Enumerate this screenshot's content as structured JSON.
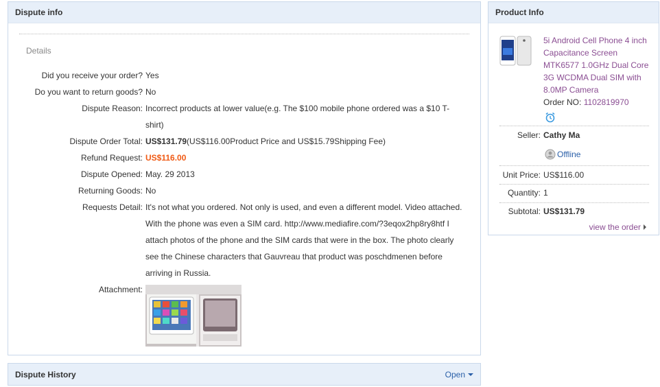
{
  "dispute_info": {
    "title": "Dispute info",
    "section_label": "Details",
    "rows": [
      {
        "label": "Did you receive your order?",
        "value": "Yes"
      },
      {
        "label": "Do you want to return goods?",
        "value": "No"
      },
      {
        "label": "Dispute Reason:",
        "value": "Incorrect products at lower value(e.g. The $100 mobile phone ordered was a $10 T-shirt)"
      },
      {
        "label": "Dispute Order Total:",
        "value_bold": "US$131.79",
        "value_rest": "(US$116.00Product Price and US$15.79Shipping Fee)"
      },
      {
        "label": "Refund Request:",
        "value": "US$116.00"
      },
      {
        "label": "Dispute Opened:",
        "value": "May. 29 2013"
      },
      {
        "label": "Returning Goods:",
        "value": "No"
      },
      {
        "label": "Requests Detail:",
        "value": "It's not what you ordered. Not only is used, and even a different model. Video attached. With the phone was even a SIM card. http://www.mediafire.com/?3eqox2hp8ry8htf I attach photos of the phone and the SIM cards that were in the box. The photo clearly see the Chinese characters that Gauvreau that product was poschdmenen before arriving in Russia."
      },
      {
        "label": "Attachment:"
      }
    ],
    "accent_color": "#f05a14"
  },
  "dispute_history": {
    "title": "Dispute History",
    "toggle_label": "Open"
  },
  "product_info": {
    "title": "Product Info",
    "product_title": "5i Android Cell Phone 4 inch Capacitance Screen MTK6577 1.0GHz Dual Core 3G WCDMA Dual SIM with 8.0MP Camera",
    "order_label": "Order NO:",
    "order_number": "1102819970",
    "seller_label": "Seller:",
    "seller_name": "Cathy Ma",
    "status": "Offline",
    "unit_price_label": "Unit Price:",
    "unit_price": "US$116.00",
    "quantity_label": "Quantity:",
    "quantity": "1",
    "subtotal_label": "Subtotal:",
    "subtotal": "US$131.79",
    "view_order_label": "view the order",
    "icons": [
      "alarm-clock-icon",
      "user-status-icon",
      "chevron-right-icon",
      "chevron-down-icon"
    ]
  }
}
